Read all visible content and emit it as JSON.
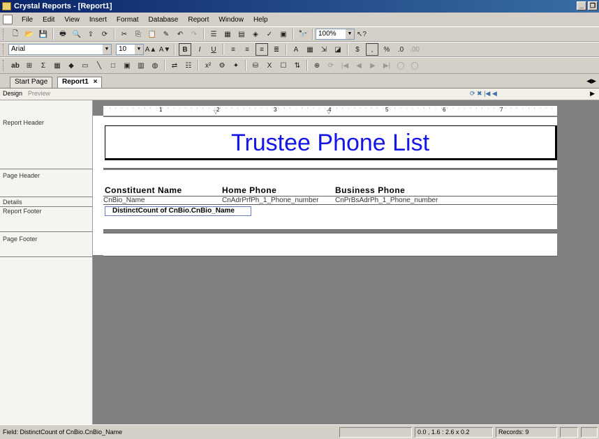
{
  "window": {
    "title": "Crystal Reports - [Report1]"
  },
  "menu": [
    "File",
    "Edit",
    "View",
    "Insert",
    "Format",
    "Database",
    "Report",
    "Window",
    "Help"
  ],
  "toolbar": {
    "zoom": "100%",
    "font_name": "Arial",
    "font_size": "10"
  },
  "tabs": {
    "start_page": "Start Page",
    "report": "Report1",
    "close": "×"
  },
  "view_tabs": {
    "design": "Design",
    "preview": "Preview"
  },
  "sections": {
    "report_header": "Report Header",
    "page_header": "Page Header",
    "details": "Details",
    "report_footer": "Report Footer",
    "page_footer": "Page Footer"
  },
  "ruler": {
    "marks": [
      "1",
      "2",
      "3",
      "4",
      "5",
      "6",
      "7"
    ]
  },
  "report": {
    "title": "Trustee Phone List",
    "headers": [
      "Constituent Name",
      "Home Phone",
      "Business Phone"
    ],
    "detail_fields": [
      "CnBio_Name",
      "CnAdrPrfPh_1_Phone_number",
      "CnPrBsAdrPh_1_Phone_number"
    ],
    "footer_field": "DistinctCount of CnBio.CnBio_Name"
  },
  "status": {
    "field": "Field: DistinctCount of CnBio.CnBio_Name",
    "position": "0.0 , 1.6 : 2.6 x 0.2",
    "records": "Records: 9"
  },
  "colors": {
    "title_blue": "#1515e8",
    "titlebar": "#0a246a"
  }
}
